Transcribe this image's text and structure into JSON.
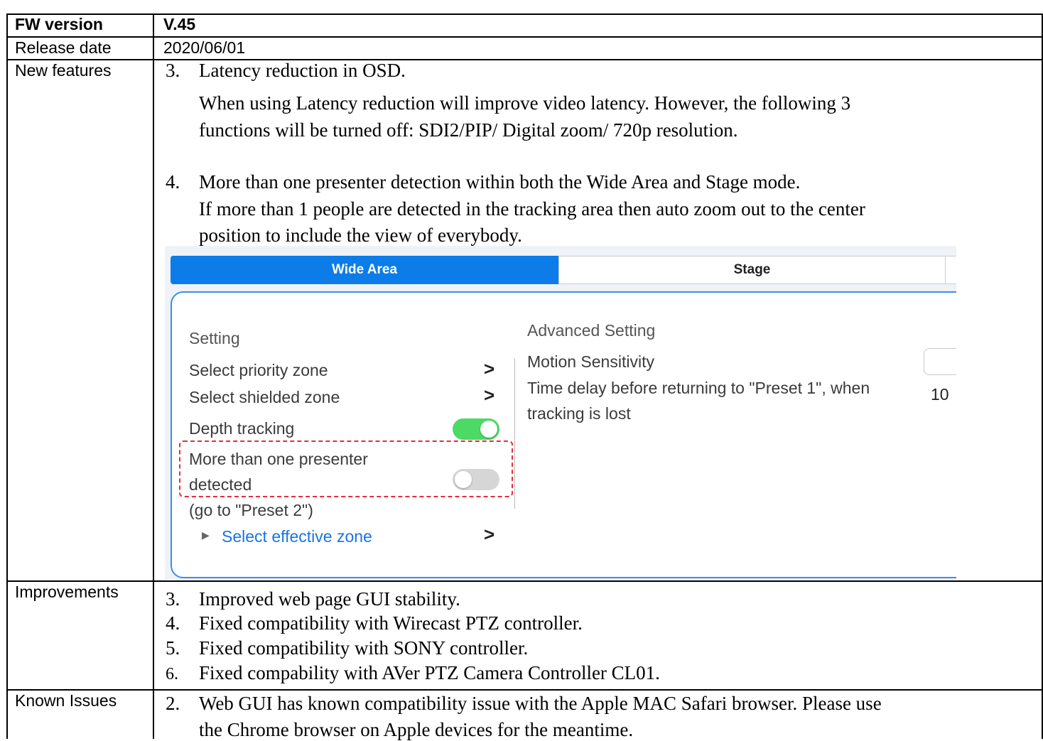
{
  "table": {
    "fw_version_label": "FW version",
    "fw_version_value": "V.45",
    "release_date_label": "Release date",
    "release_date_value": "2020/06/01",
    "new_features_label": "New features",
    "improvements_label": "Improvements",
    "known_issues_label": "Known Issues"
  },
  "new_features": [
    {
      "number": "3.",
      "title": "Latency reduction in OSD.",
      "lines": [
        "When using Latency reduction will improve video latency.  However, the following 3",
        "functions will be turned off: SDI2/PIP/ Digital zoom/ 720p resolution."
      ]
    },
    {
      "number": "4.",
      "title": "More than one presenter detection within both the Wide Area and Stage mode.",
      "lines": [
        "If more than 1 people are detected in the tracking area then auto zoom out to the center",
        "position to include the view of everybody."
      ]
    }
  ],
  "screenshot": {
    "tabs": [
      "Wide Area",
      "Stage"
    ],
    "setting_heading": "Setting",
    "items": {
      "priority_zone": "Select priority zone",
      "shielded_zone": "Select shielded zone",
      "depth_tracking": "Depth tracking",
      "multi_presenter_line1": "More than one presenter",
      "multi_presenter_line2": "detected",
      "go_to_preset": "(go to \"Preset 2\")",
      "effective_zone": "Select effective zone"
    },
    "toggles": {
      "depth_tracking": true,
      "multi_presenter": false
    },
    "advanced": {
      "heading": "Advanced Setting",
      "motion_sensitivity": "Motion Sensitivity",
      "time_delay_line1": "Time delay before returning to \"Preset 1\", when",
      "time_delay_line2": "tracking is lost",
      "time_delay_value": "10"
    },
    "icons": {
      "chevron": "chevron-right-icon",
      "expand": "triangle-right-icon"
    }
  },
  "improvements": [
    {
      "number": "3.",
      "text": "Improved web page GUI stability."
    },
    {
      "number": "4.",
      "text": "Fixed compatibility with Wirecast PTZ controller."
    },
    {
      "number": "5.",
      "text": "Fixed compatibility with SONY controller."
    },
    {
      "number": "6.",
      "text": "Fixed compability with AVer PTZ Camera Controller CL01."
    }
  ],
  "known_issues": [
    {
      "number": "2.",
      "lines": [
        "Web GUI has known compatibility issue with the Apple MAC Safari browser.  Please use",
        "the Chrome browser on Apple devices for the meantime."
      ]
    }
  ],
  "colors": {
    "tab_active": "#0b7ce8",
    "toggle_on": "#4cd964",
    "highlight": "#e0303a",
    "link": "#1a73e8"
  }
}
